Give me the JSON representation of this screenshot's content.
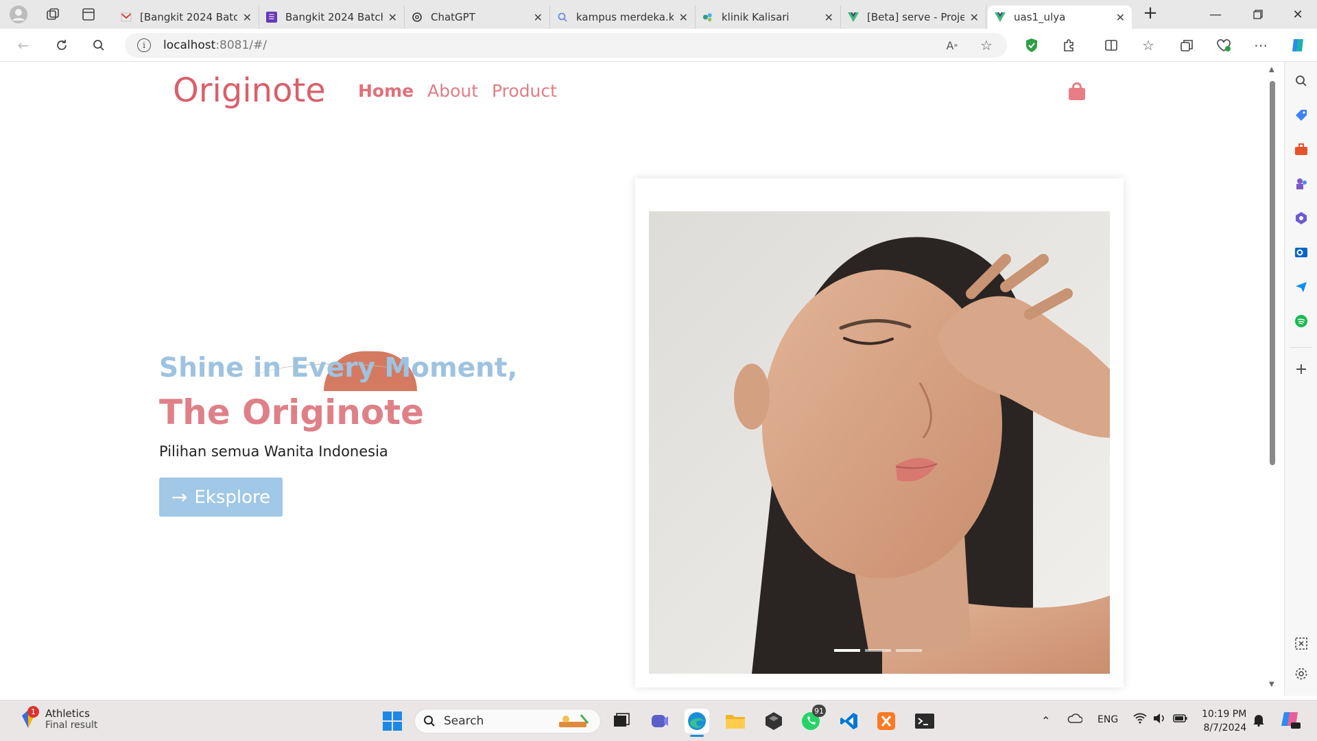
{
  "browser": {
    "tabs": [
      {
        "title": "[Bangkit 2024 Batch",
        "icon": "gmail-icon",
        "color": "#d44638"
      },
      {
        "title": "Bangkit 2024 Batch",
        "icon": "forms-icon",
        "color": "#673ab7"
      },
      {
        "title": "ChatGPT",
        "icon": "openai-icon",
        "color": "#333333"
      },
      {
        "title": "kampus merdeka.ke",
        "icon": "search-icon",
        "color": "#6b8fd6"
      },
      {
        "title": "klinik Kalisari",
        "icon": "clinic-icon",
        "color": "#2b9c8f"
      },
      {
        "title": "[Beta] serve - Projec",
        "icon": "vue-icon",
        "color": "#41b883"
      },
      {
        "title": "uas1_ulya",
        "icon": "vue-icon",
        "color": "#41b883"
      }
    ],
    "address": {
      "host": "localhost",
      "rest": ":8081/#/"
    }
  },
  "site": {
    "brand": "Originote",
    "nav": {
      "home": "Home",
      "about": "About",
      "product": "Product"
    },
    "hero": {
      "line1": "Shine in Every Moment,",
      "line2": "The Originote",
      "subtitle": "Pilihan semua Wanita Indonesia",
      "cta": "Eksplore"
    },
    "carousel": {
      "slides": 3,
      "active": 0
    },
    "colors": {
      "brand": "#d9606a",
      "accent_blue": "#a1c8e6",
      "accent_pink": "#df8088"
    }
  },
  "taskbar": {
    "weather": {
      "title": "Athletics",
      "subtitle": "Final result",
      "badge": "1"
    },
    "search_label": "Search",
    "whatsapp_badge": "91",
    "lang": "ENG",
    "time": "10:19 PM",
    "date": "8/7/2024"
  }
}
